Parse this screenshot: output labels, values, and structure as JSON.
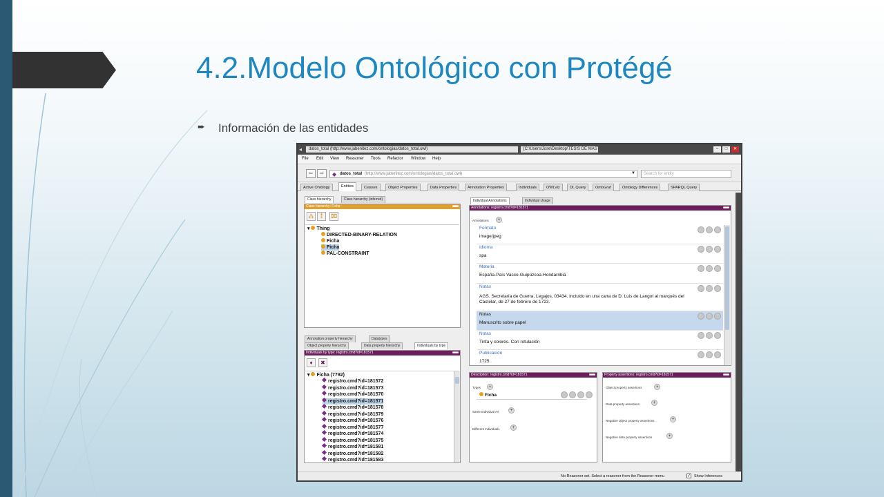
{
  "slide": {
    "title": "4.2.Modelo Ontológico con Protégé",
    "bullet_icon": "arrow-bullet-icon",
    "bullet_text": "Información de las entidades",
    "accent_color": "#1e87c0",
    "bar_color": "#2b5872"
  },
  "app": {
    "window_title": "datos_total (http://www.jabenitez.com/ontologias/datos_total.owl)",
    "window_path": "[C:\\Users\\Jose\\Desktop\\TESIS DE MASTER\\RDF\\datos_total.owl]",
    "menu": [
      "File",
      "Edit",
      "View",
      "Reasoner",
      "Tools",
      "Refactor",
      "Window",
      "Help"
    ],
    "ontology_name": "datos_total",
    "ontology_url": "(http://www.jabenitez.com/ontologias/datos_total.owl)",
    "search_placeholder": "Search for entity",
    "tabs": [
      "Active Ontology",
      "Entities",
      "Classes",
      "Object Properties",
      "Data Properties",
      "Annotation Properties",
      "Individuals",
      "OWLViz",
      "DL Query",
      "OntoGraf",
      "Ontology Differences",
      "SPARQL Query"
    ],
    "status": {
      "message": "No Reasoner set. Select a reasoner from the Reasoner menu",
      "show_inferences": "Show Inferences"
    }
  },
  "class_panel": {
    "subtabs": [
      "Class hierarchy",
      "Class hierarchy (inferred)"
    ],
    "header": "Class hierarchy: Ficha",
    "tree": [
      "Thing",
      "DIRECTED-BINARY-RELATION",
      "Ficha",
      "Ficha",
      "PAL-CONSTRAINT"
    ]
  },
  "individuals_panel": {
    "subtabs_row1": [
      "Annotation property hierarchy",
      "Datatypes"
    ],
    "subtabs_row2": [
      "Object property hierarchy",
      "Data property hierarchy",
      "Individuals by type"
    ],
    "header": "Individuals by type: registro.cmd?id=181571",
    "root": "Ficha (7792)",
    "items": [
      "registro.cmd?id=181572",
      "registro.cmd?id=181573",
      "registro.cmd?id=181570",
      "registro.cmd?id=181571",
      "registro.cmd?id=181578",
      "registro.cmd?id=181579",
      "registro.cmd?id=181576",
      "registro.cmd?id=181577",
      "registro.cmd?id=181574",
      "registro.cmd?id=181575",
      "registro.cmd?id=181581",
      "registro.cmd?id=181582",
      "registro.cmd?id=181583"
    ]
  },
  "annotations_panel": {
    "subtabs": [
      "Individual Annotations",
      "Individual Usage"
    ],
    "header": "Annotations: registro.cmd?id=181571",
    "label": "Annotations",
    "rows": [
      {
        "property": "Formato",
        "value": "image/jpeg"
      },
      {
        "property": "Idioma",
        "value": "spa"
      },
      {
        "property": "Materia",
        "value": "España-País Vasco-Guipúzcoa-Hondarribia"
      },
      {
        "property": "Notas",
        "value": "AGS. Secretaría de Guerra, Legajos, 03434. Incluido en una carta de D. Luis de Langot al marqués del",
        "value2": "Castelar, de 27 de febrero de 1723."
      },
      {
        "property": "Notas",
        "value": "Manuscrito sobre papel"
      },
      {
        "property": "Notas",
        "value": "Tinta y colores. Con rotulación"
      },
      {
        "property": "Publicación",
        "value": "1725"
      }
    ]
  },
  "description_panel": {
    "header": "Description: registro.cmd?id=181571",
    "types_label": "Types",
    "type_value": "Ficha",
    "same_label": "Same Individual As",
    "different_label": "Different Individuals"
  },
  "assertions_panel": {
    "header": "Property assertions: registro.cmd?id=181571",
    "labels": [
      "Object property assertions",
      "Data property assertions",
      "Negative object property assertions",
      "Negative data property assertions"
    ]
  }
}
